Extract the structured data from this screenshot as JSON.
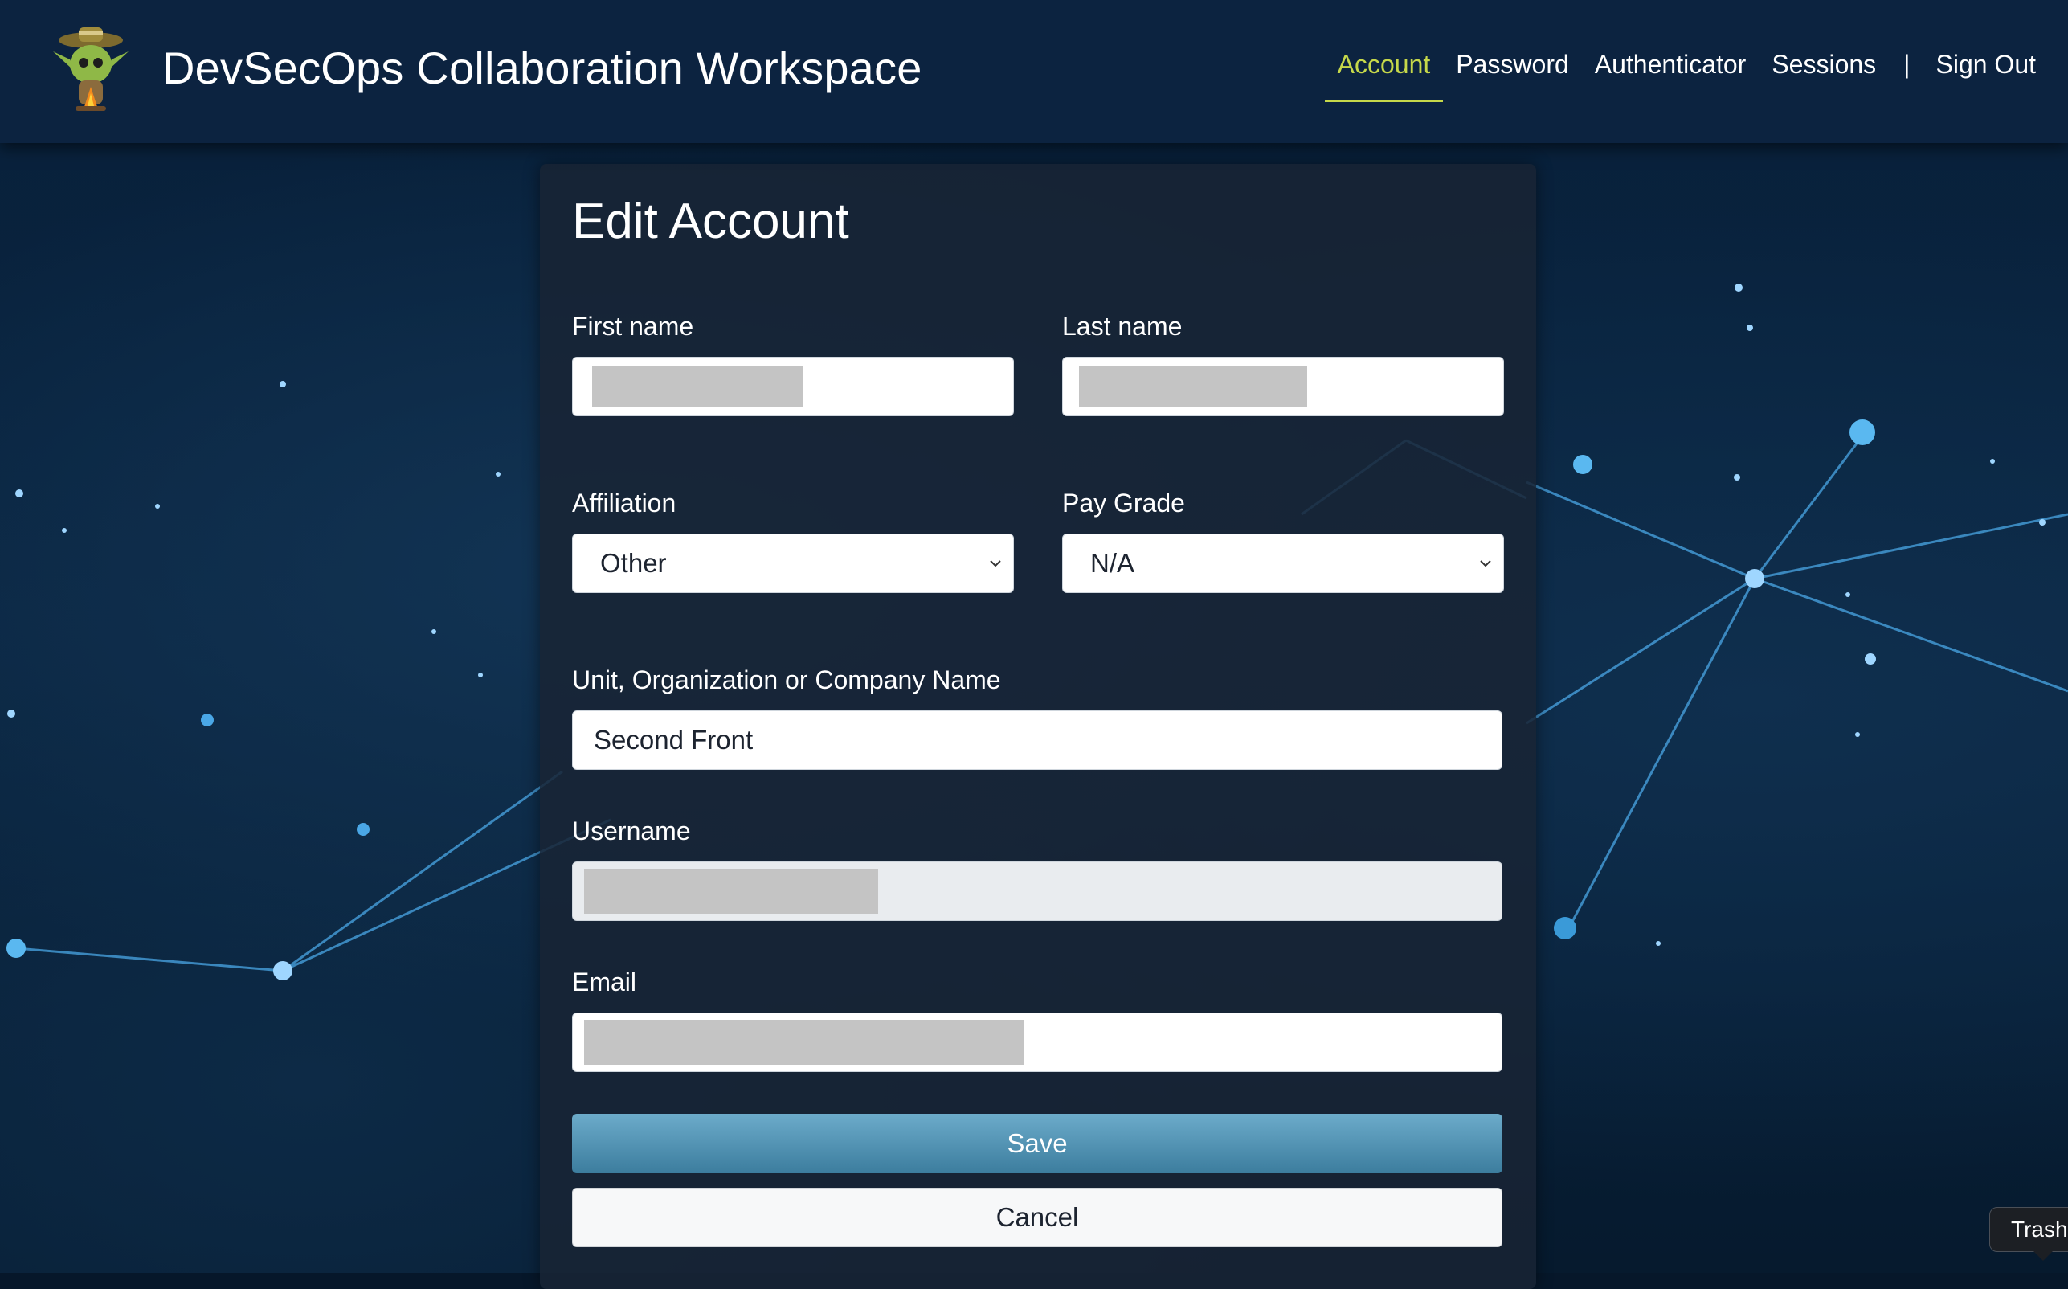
{
  "header": {
    "title": "DevSecOps Collaboration Workspace",
    "nav": {
      "account": "Account",
      "password": "Password",
      "authenticator": "Authenticator",
      "sessions": "Sessions",
      "separator": "|",
      "sign_out": "Sign Out"
    },
    "accent_color": "#c6d84a"
  },
  "form": {
    "title": "Edit Account",
    "first_name": {
      "label": "First name",
      "value": ""
    },
    "last_name": {
      "label": "Last name",
      "value": ""
    },
    "affiliation": {
      "label": "Affiliation",
      "selected": "Other"
    },
    "pay_grade": {
      "label": "Pay Grade",
      "selected": "N/A"
    },
    "organization": {
      "label": "Unit, Organization or Company Name",
      "value": "Second Front"
    },
    "username": {
      "label": "Username",
      "value": ""
    },
    "email": {
      "label": "Email",
      "value": ""
    },
    "save_label": "Save",
    "cancel_label": "Cancel"
  },
  "tooltip": {
    "text": "Trash"
  }
}
